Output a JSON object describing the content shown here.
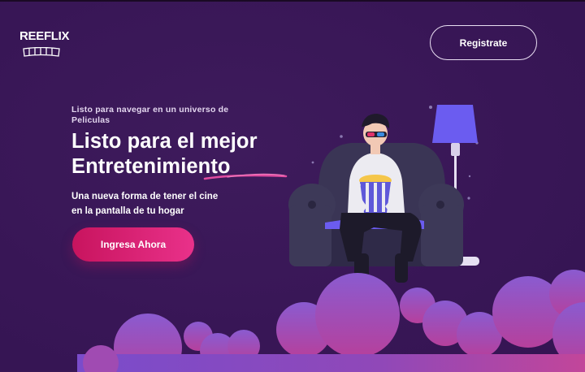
{
  "brand": {
    "logo_text": "REEFLIX"
  },
  "header": {
    "register_label": "Registrate"
  },
  "hero": {
    "eyebrow": "Listo para navegar en un universo de Peliculas",
    "headline_line1": "Listo para el mejor",
    "headline_line2": "Entretenimiento",
    "subtitle_line1": "Una nueva forma de tener el cine",
    "subtitle_line2": "en la pantalla de tu hogar",
    "cta_label": "Ingresa Ahora"
  },
  "colors": {
    "background": "#3a1856",
    "cta_start": "#c8145e",
    "cta_end": "#e9318a",
    "accent_purple": "#6b5cf0"
  },
  "icons": [
    "film-strip-icon",
    "popcorn-icon",
    "lamp-icon"
  ]
}
